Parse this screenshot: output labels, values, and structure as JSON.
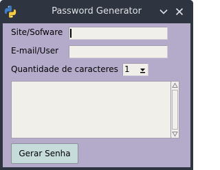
{
  "window": {
    "title": "Password Generator",
    "app_icon": "python-icon",
    "minimize_icon": "chevron-down-icon",
    "close_icon": "close-icon"
  },
  "form": {
    "site_label": "Site/Sofware",
    "site_value": "",
    "email_label": "E-mail/User",
    "email_value": "",
    "length_label": "Quantidade de caracteres",
    "length_value": "1",
    "length_dropdown_icon": "triangle-down-icon",
    "output_text": "",
    "scroll_up_icon": "triangle-up-icon",
    "scroll_down_icon": "triangle-down-icon",
    "generate_button": "Gerar Senha"
  },
  "colors": {
    "titlebar": "#2f3441",
    "background": "#b4abcb",
    "field": "#f1efe9",
    "button": "#c5dcdb"
  }
}
